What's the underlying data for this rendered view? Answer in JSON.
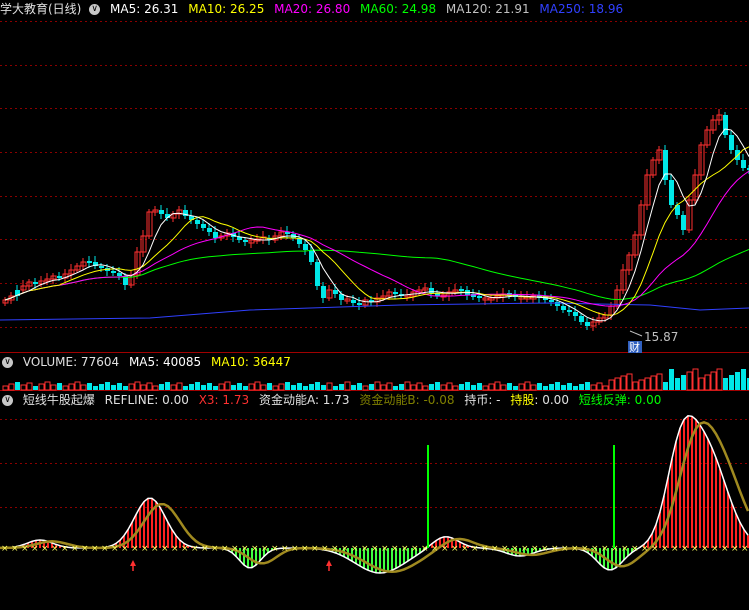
{
  "header_main": {
    "title": "学大教育(日线)",
    "ma5": "MA5: 26.31",
    "ma10": "MA10: 26.25",
    "ma20": "MA20: 26.80",
    "ma60": "MA60: 24.98",
    "ma120": "MA120: 21.91",
    "ma250": "MA250: 18.96",
    "colors": {
      "ma5": "#ffffff",
      "ma10": "#ffff00",
      "ma20": "#ff00ff",
      "ma60": "#00ff00",
      "ma120": "#c0c0c0",
      "ma250": "#3040ff"
    }
  },
  "annotations": {
    "low_price": "15.87",
    "finance_badge": "财"
  },
  "header_volume": {
    "label": "VOLUME: 77604",
    "ma5": "MA5: 40085",
    "ma10": "MA10: 36447"
  },
  "header_indicator": {
    "name": "短线牛股起爆",
    "refline": "REFLINE: 0.00",
    "x3": "X3: 1.73",
    "fund_a": "资金动能A: 1.73",
    "fund_b": "资金动能B: -0.08",
    "hold_coin": "持币: -",
    "hold_stock_label": "持股",
    "hold_stock_value": ": 0.00",
    "rebound": "短线反弹: 0.00"
  },
  "icons": {
    "collapse": "collapse-circle-icon"
  },
  "chart_data": [
    {
      "type": "candlestick",
      "panel": "price",
      "low_label": 15.87,
      "series": [
        {
          "name": "MA5",
          "color": "#ffffff"
        },
        {
          "name": "MA10",
          "color": "#ffff00"
        },
        {
          "name": "MA20",
          "color": "#ff00ff"
        },
        {
          "name": "MA60",
          "color": "#00ff00"
        },
        {
          "name": "MA250",
          "color": "#3040ff"
        }
      ]
    },
    {
      "type": "bar",
      "panel": "volume",
      "series": [
        {
          "name": "VOLUME",
          "last": 77604
        },
        {
          "name": "MA5",
          "last": 40085
        },
        {
          "name": "MA10",
          "last": 36447
        }
      ]
    },
    {
      "type": "bar",
      "panel": "indicator",
      "series": [
        {
          "name": "资金动能A",
          "last": 1.73
        },
        {
          "name": "资金动能B",
          "last": -0.08
        }
      ]
    }
  ]
}
